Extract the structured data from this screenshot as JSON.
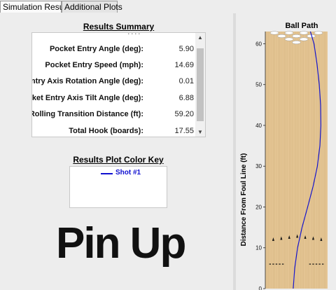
{
  "tabs": [
    {
      "label": "Simulation Results",
      "active": true
    },
    {
      "label": "Additional Plots",
      "active": false
    }
  ],
  "summary": {
    "title": "Results Summary",
    "rows": [
      {
        "label": "Pocket Entry Angle (deg):",
        "value": "5.90"
      },
      {
        "label": "Pocket Entry Speed (mph):",
        "value": "14.69"
      },
      {
        "label": "Pocket Entry Axis Rotation Angle (deg):",
        "value": "0.01"
      },
      {
        "label": "Pocket Entry Axis Tilt Angle (deg):",
        "value": "6.88"
      },
      {
        "label": "Rolling Transition Distance (ft):",
        "value": "59.20"
      },
      {
        "label": "Total Hook (boards):",
        "value": "17.55"
      }
    ]
  },
  "color_key": {
    "title": "Results Plot Color Key",
    "entries": [
      {
        "label": "Shot #1",
        "color": "#1010d0"
      }
    ]
  },
  "logo_text": "Pin Up",
  "colors": {
    "lane": "#e6c796",
    "board_line": "#cfae78",
    "path": "#1515cc",
    "arrow": "#111111"
  },
  "chart_data": {
    "type": "line",
    "title": "Ball Path",
    "ylabel": "Distance From Foul Line (ft)",
    "xlabel": "",
    "ylim": [
      0,
      63
    ],
    "yticks": [
      0,
      10,
      20,
      30,
      40,
      50,
      60
    ],
    "xlim": [
      0,
      39
    ],
    "x_unit": "boards from left edge of lane",
    "series": [
      {
        "name": "Shot #1",
        "x": [
          17.5,
          18.4,
          20.2,
          23.0,
          26.5,
          29.9,
          32.6,
          34.2,
          34.8,
          34.6,
          33.8,
          32.4,
          30.5,
          28.2
        ],
        "y": [
          0,
          5,
          10,
          15,
          20,
          25,
          30,
          35,
          40,
          45,
          50,
          55,
          60,
          63
        ]
      }
    ],
    "arrows": {
      "y": 12.8,
      "boards": [
        5,
        10,
        15,
        20,
        25,
        30,
        35
      ]
    },
    "dots": {
      "y": 6.0,
      "boards": [
        3,
        5,
        7,
        9,
        11,
        28,
        30,
        32,
        34,
        36
      ]
    },
    "pins": {
      "count": 10
    },
    "grid": false
  }
}
